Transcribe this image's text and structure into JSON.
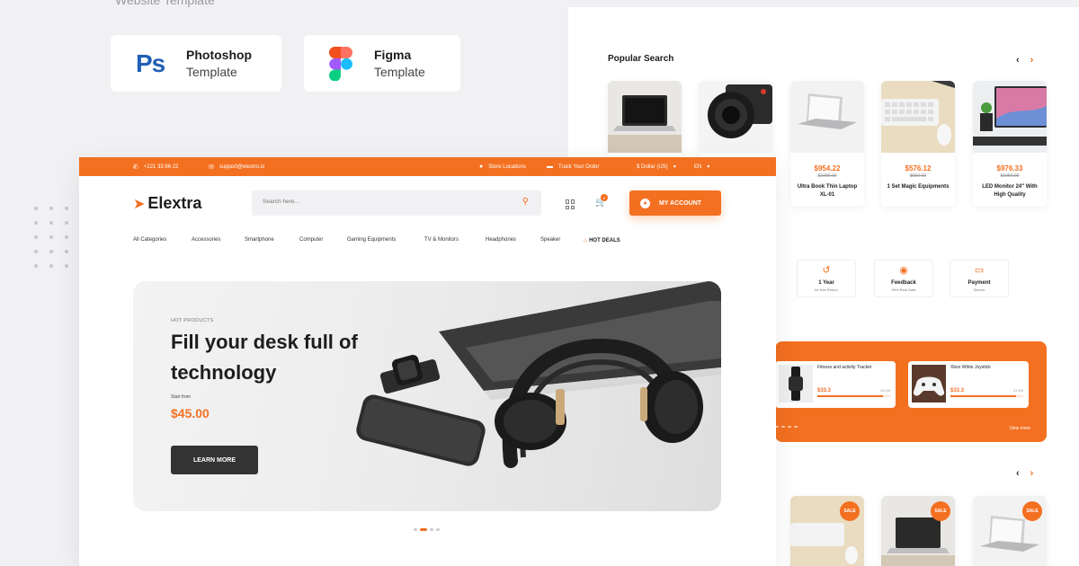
{
  "caption": "Website Template",
  "badges": [
    {
      "title": "Photoshop",
      "subtitle": "Template",
      "logo_text": "Ps"
    },
    {
      "title": "Figma",
      "subtitle": "Template"
    }
  ],
  "topbar": {
    "phone": "+221 33 66 22",
    "email": "support@elextro.io",
    "store_locations": "Store Locations",
    "track_order": "Track Your Order",
    "currency": "$ Dollar (US)",
    "language": "EN"
  },
  "header": {
    "logo": "Elextra",
    "search_placeholder": "Search here...",
    "cart_count": "0",
    "account_label": "MY ACCOUNT"
  },
  "nav": {
    "items": [
      "All Categories",
      "Accessories",
      "Smartphone",
      "Computer",
      "Gaming Equipments",
      "TV & Monitors",
      "Headphones",
      "Speaker"
    ],
    "hot_deals": "HOT DEALS"
  },
  "hero": {
    "eyebrow": "HOT PRODUCTS",
    "title": "Fill your desk full of technology",
    "start_label": "Start from",
    "price": "$45.00",
    "button": "LEARN MORE"
  },
  "popular": {
    "title": "Popular Search",
    "products": [
      {
        "name": "",
        "price": "",
        "old_price": ""
      },
      {
        "name": "",
        "price": "",
        "old_price": ""
      },
      {
        "name": "Ultra Book Thin Laptop XL-01",
        "price": "$954.22",
        "old_price": "$1000.00"
      },
      {
        "name": "1 Set Magic Equipments",
        "price": "$576.12",
        "old_price": "$650.00"
      },
      {
        "name": "LED Monitor 24\" With High Quality",
        "price": "$976.33",
        "old_price": "$1050.00"
      }
    ]
  },
  "features": [
    {
      "title": "1 Year",
      "subtitle": "for free Return"
    },
    {
      "title": "Feedback",
      "subtitle": "99% Real Data"
    },
    {
      "title": "Payment",
      "subtitle": "Secure"
    }
  ],
  "deals": {
    "items": [
      {
        "name": "Fitness and activity Tracker",
        "price": "$33.3",
        "left": "24 left",
        "progress": 0.9
      },
      {
        "name": "Xbox White Joystick",
        "price": "$33.3",
        "left": "24 left",
        "progress": 0.9
      }
    ],
    "view_more": "View more"
  },
  "sale": {
    "badge": "SALE"
  },
  "colors": {
    "accent": "#f37021",
    "dark": "#333333",
    "lilac": "#b6b3fb",
    "peach": "#fdd6bd"
  }
}
